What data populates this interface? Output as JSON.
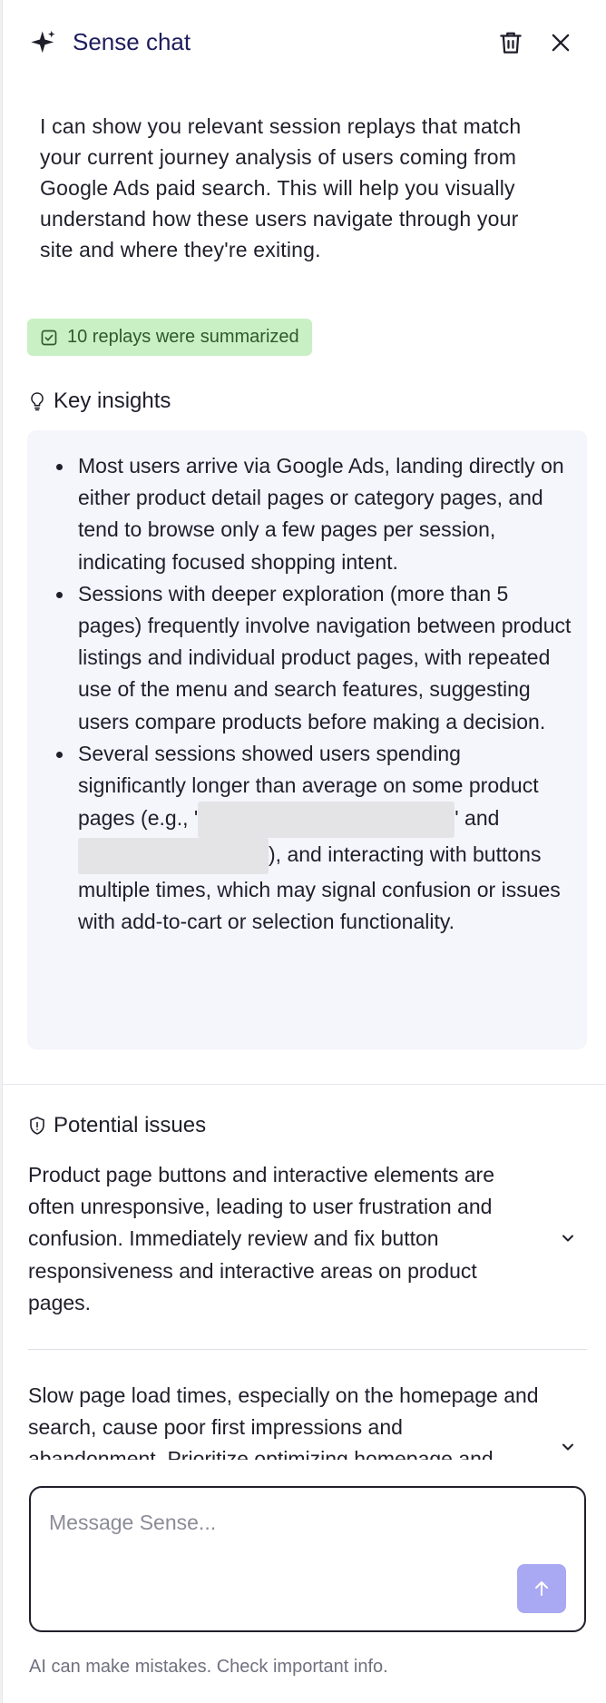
{
  "header": {
    "title": "Sense chat",
    "icons": [
      "sparkle-icon",
      "trash-icon",
      "close-icon"
    ]
  },
  "message": {
    "intro": "I can show you relevant session replays that match your current journey analysis of users coming from Google Ads paid search. This will help you visually understand how these users navigate through your site and where they're exiting.",
    "badge": "10 replays were summarized"
  },
  "insights": {
    "heading": "Key insights",
    "items": [
      "Most users arrive via Google Ads, landing directly on either product detail pages or category pages, and tend to browse only a few pages per session, indicating focused shopping intent.",
      "Sessions with deeper exploration (more than 5 pages) frequently involve navigation between product listings and individual product pages, with repeated use of the menu and search features, suggesting users compare products before making a decision."
    ],
    "item3": {
      "part1": "Several sessions showed users spending significantly longer than average on some product pages (e.g., '",
      "part2": "' and ",
      "part3": "), and interacting with buttons multiple times, which may signal confusion or issues with add-to-cart or selection functionality."
    }
  },
  "issues": {
    "heading": "Potential issues",
    "items": [
      "Product page buttons and interactive elements are often unresponsive, leading to user frustration and confusion. Immediately review and fix button responsiveness and interactive areas on product pages.",
      "Slow page load times, especially on the homepage and search, cause poor first impressions and abandonment. Prioritize optimizing homepage and"
    ]
  },
  "composer": {
    "placeholder": "Message Sense..."
  },
  "footer": {
    "disclaimer": "AI can make mistakes. Check important info."
  },
  "colors": {
    "accent": "#a9a8f2",
    "badge_bg": "#c9f0c4",
    "insights_bg": "#f5f5fc",
    "title": "#1d1d5e"
  }
}
